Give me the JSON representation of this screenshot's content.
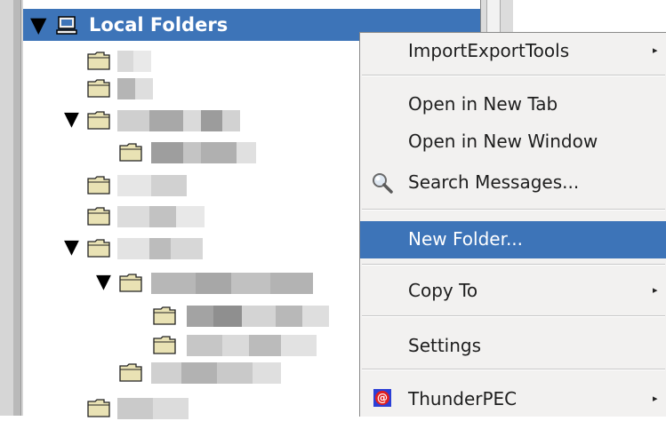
{
  "tree": {
    "root_label": "Local Folders",
    "root_twisty": "▼"
  },
  "menu": {
    "items": [
      {
        "label": "ImportExportTools",
        "submenu": true
      },
      {
        "label": "Open in New Tab",
        "submenu": false
      },
      {
        "label": "Open in New Window",
        "submenu": false
      },
      {
        "label": "Search Messages...",
        "submenu": false
      },
      {
        "label": "New Folder...",
        "submenu": false,
        "highlighted": true
      },
      {
        "label": "Copy To",
        "submenu": true
      },
      {
        "label": "Settings",
        "submenu": false
      },
      {
        "label": "ThunderPEC",
        "submenu": true
      }
    ],
    "submenu_arrow": "▸"
  },
  "colors": {
    "selection": "#3d74b8",
    "menu_bg": "#f2f1f0",
    "folder": "#e9e2b4"
  }
}
